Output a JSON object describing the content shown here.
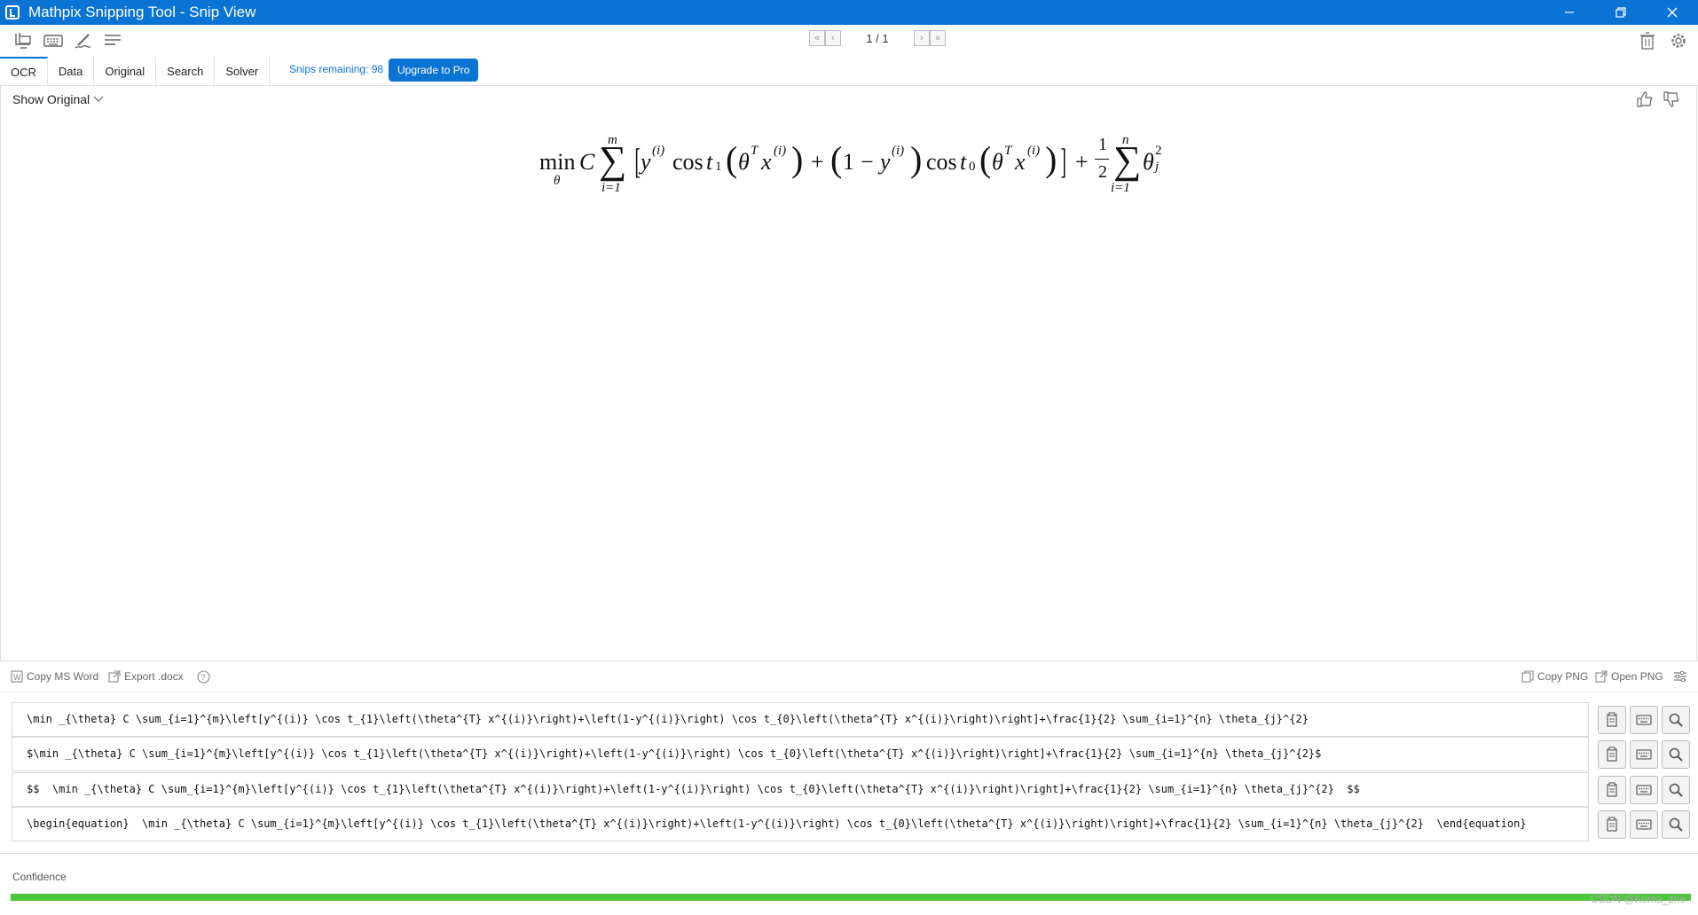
{
  "window": {
    "title": "Mathpix Snipping Tool - Snip View",
    "controls": [
      "minimize",
      "restore",
      "close"
    ]
  },
  "toolbar": {
    "icons": [
      "screen-snip-icon",
      "keyboard-icon",
      "pen-icon",
      "text-lines-icon"
    ],
    "pager": "1 / 1",
    "right_icons": [
      "trash-icon",
      "gear-icon"
    ]
  },
  "tabs": [
    {
      "label": "OCR",
      "active": true
    },
    {
      "label": "Data",
      "active": false
    },
    {
      "label": "Original",
      "active": false
    },
    {
      "label": "Search",
      "active": false
    },
    {
      "label": "Solver",
      "active": false
    }
  ],
  "snips_remaining": "Snips remaining: 98",
  "upgrade_label": "Upgrade to Pro",
  "show_original": "Show Original",
  "actions": {
    "copy_ms_word": "Copy MS Word",
    "export_docx": "Export .docx",
    "copy_png": "Copy PNG",
    "open_png": "Open PNG"
  },
  "results": [
    "\\min _{\\theta} C \\sum_{i=1}^{m}\\left[y^{(i)} \\cos t_{1}\\left(\\theta^{T} x^{(i)}\\right)+\\left(1-y^{(i)}\\right) \\cos t_{0}\\left(\\theta^{T} x^{(i)}\\right)\\right]+\\frac{1}{2} \\sum_{i=1}^{n} \\theta_{j}^{2}",
    "$\\min _{\\theta} C \\sum_{i=1}^{m}\\left[y^{(i)} \\cos t_{1}\\left(\\theta^{T} x^{(i)}\\right)+\\left(1-y^{(i)}\\right) \\cos t_{0}\\left(\\theta^{T} x^{(i)}\\right)\\right]+\\frac{1}{2} \\sum_{i=1}^{n} \\theta_{j}^{2}$",
    "$$  \\min _{\\theta} C \\sum_{i=1}^{m}\\left[y^{(i)} \\cos t_{1}\\left(\\theta^{T} x^{(i)}\\right)+\\left(1-y^{(i)}\\right) \\cos t_{0}\\left(\\theta^{T} x^{(i)}\\right)\\right]+\\frac{1}{2} \\sum_{i=1}^{n} \\theta_{j}^{2}  $$",
    "\\begin{equation}  \\min _{\\theta} C \\sum_{i=1}^{m}\\left[y^{(i)} \\cos t_{1}\\left(\\theta^{T} x^{(i)}\\right)+\\left(1-y^{(i)}\\right) \\cos t_{0}\\left(\\theta^{T} x^{(i)}\\right)\\right]+\\frac{1}{2} \\sum_{i=1}^{n} \\theta_{j}^{2}  \\end{equation}"
  ],
  "math": {
    "min": "min",
    "theta": "θ",
    "C": "C",
    "sigma": "∑",
    "m": "m",
    "i_eq_1": "i=1",
    "lbracket": "[",
    "y": "y",
    "i_sup": "(i)",
    "cos": "cos",
    "t": "t",
    "one": "1",
    "zero": "0",
    "lparen": "(",
    "rparen": ")",
    "T": "T",
    "x": "x",
    "plus": "+",
    "minus": "−",
    "rbracket": "]",
    "half_num": "1",
    "half_den": "2",
    "n": "n",
    "j": "j",
    "two": "2"
  },
  "confidence": {
    "label": "Confidence",
    "value": 1.0,
    "color": "#4ec63c"
  },
  "watermark": "CSDN @Koma_zhe"
}
